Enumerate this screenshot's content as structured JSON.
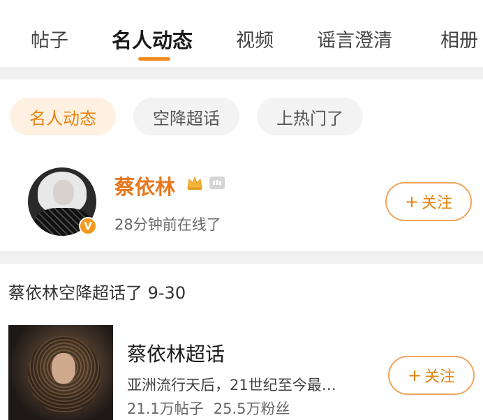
{
  "tabs": [
    {
      "label": "帖子"
    },
    {
      "label": "名人动态"
    },
    {
      "label": "视频"
    },
    {
      "label": "谣言澄清"
    },
    {
      "label": "相册"
    }
  ],
  "active_tab": "名人动态",
  "filters": [
    {
      "label": "名人动态"
    },
    {
      "label": "空降超话"
    },
    {
      "label": "上热门了"
    }
  ],
  "celebrity": {
    "name": "蔡依林",
    "status": "28分钟前在线了",
    "follow_label": "关注",
    "verified_mark": "V",
    "icons": {
      "crown": "crown-icon",
      "level": "level-badge-icon",
      "verified": "verified-icon"
    }
  },
  "section": {
    "title": "蔡依林空降超话了 9-30"
  },
  "supertopic": {
    "name": "蔡依林超话",
    "description": "亚洲流行天后，21世纪至今最…",
    "posts": "21.1万帖子",
    "fans": "25.5万粉丝",
    "follow_label": "关注"
  },
  "colors": {
    "accent": "#e7820f",
    "chip_active_bg": "#fff1e2",
    "separator": "#f1f1f1"
  }
}
